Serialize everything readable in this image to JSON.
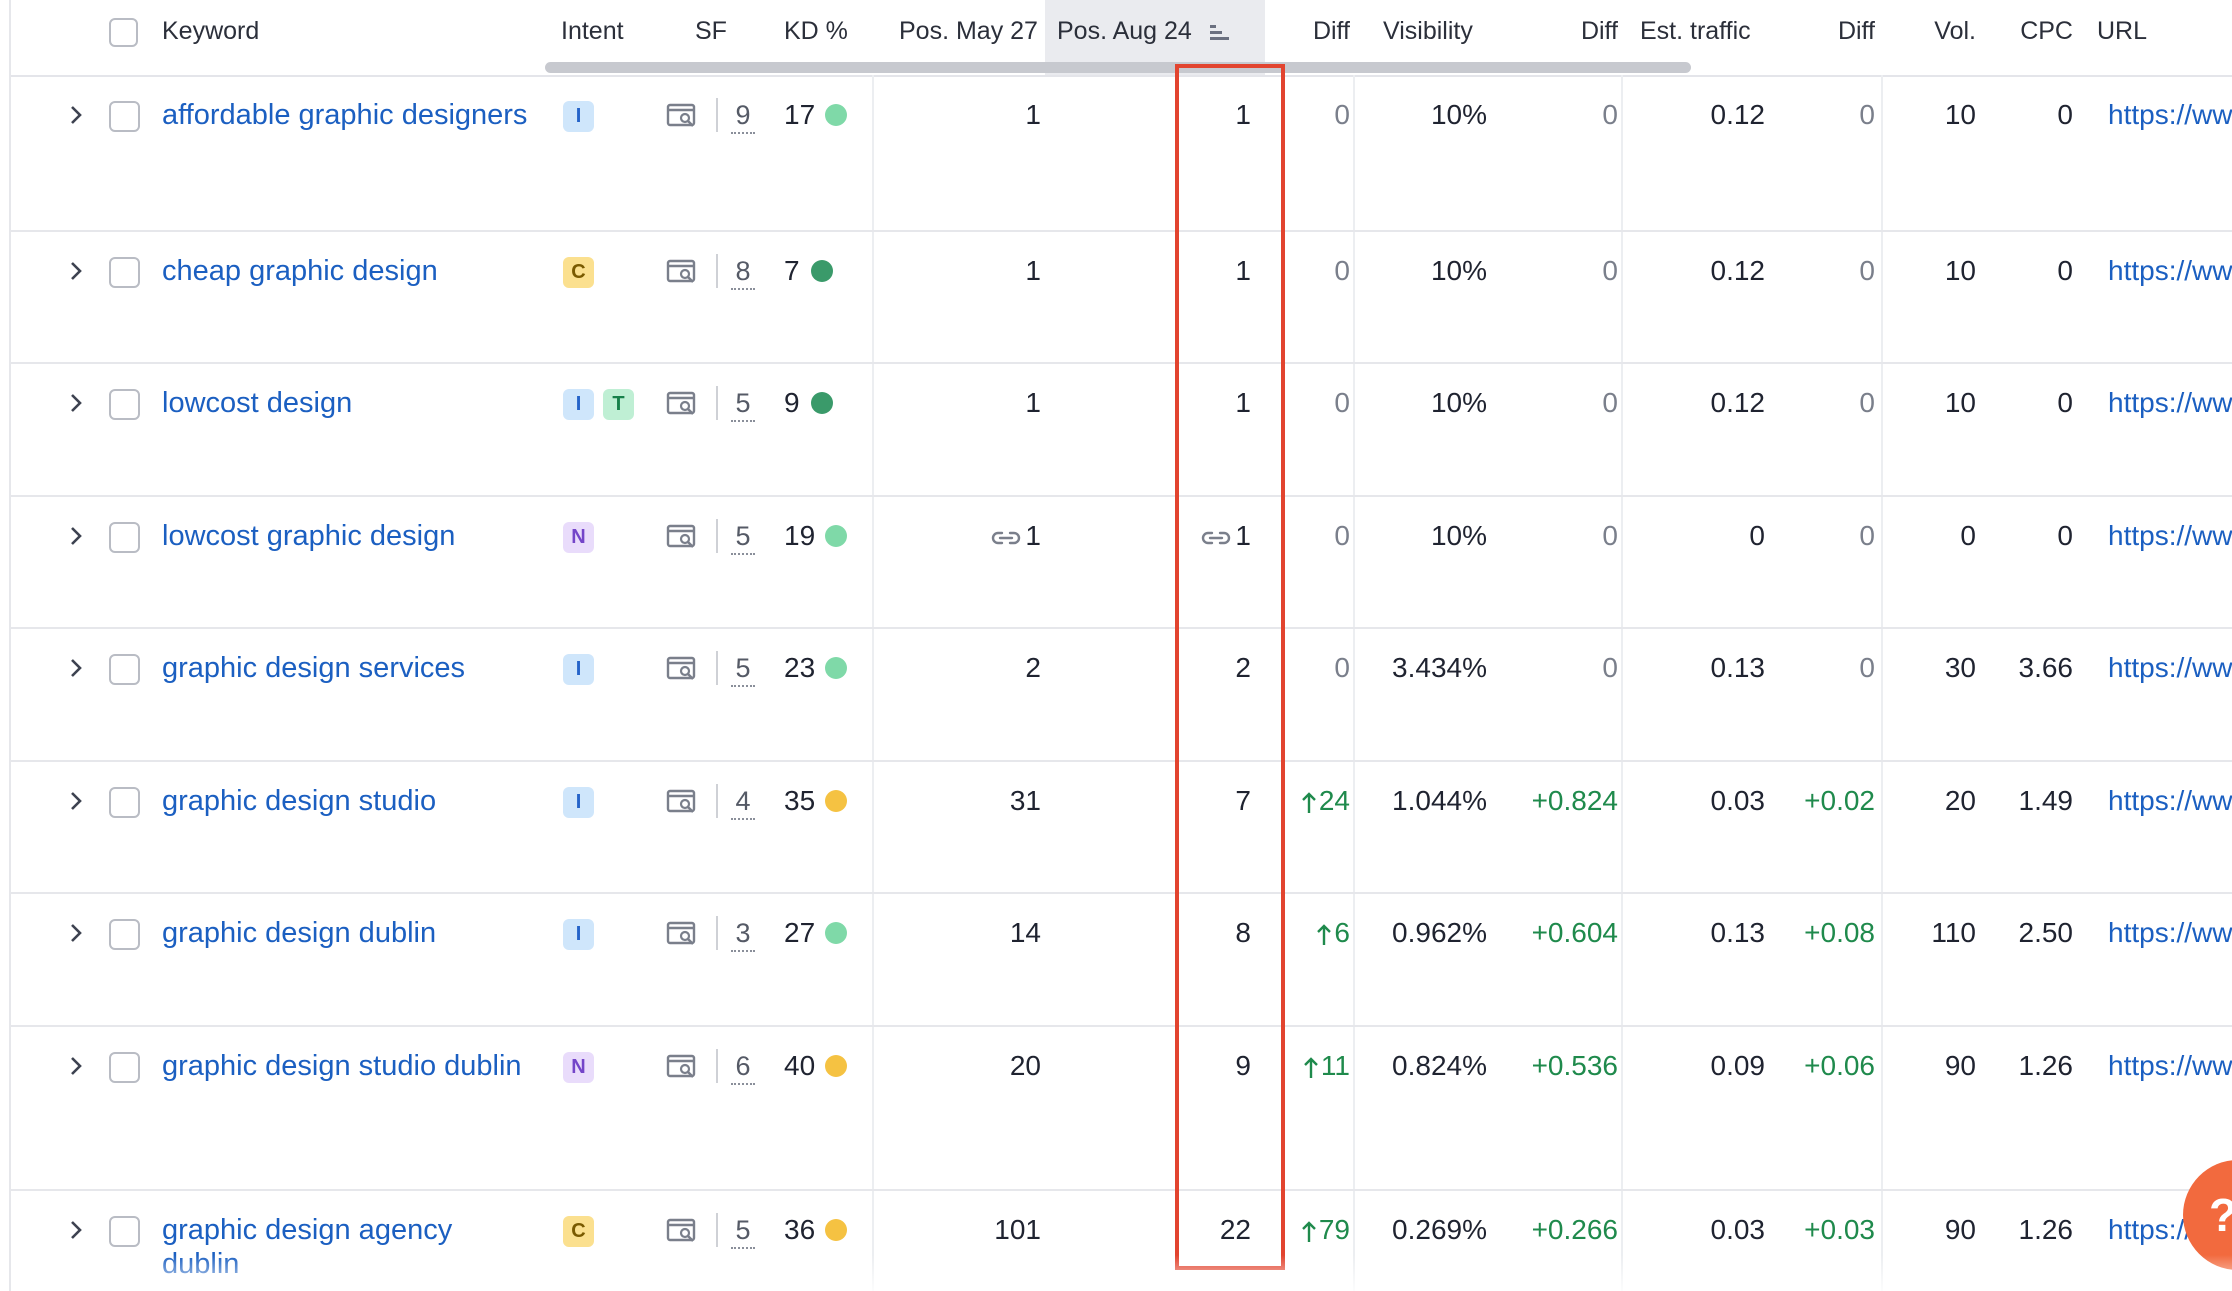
{
  "headers": {
    "keyword": "Keyword",
    "intent": "Intent",
    "sf": "SF",
    "kd": "KD %",
    "pos_may": "Pos. May 27",
    "pos_aug": "Pos. Aug 24",
    "diff_pos": "Diff",
    "visibility": "Visibility",
    "diff_vis": "Diff",
    "traffic": "Est. traffic",
    "diff_traffic": "Diff",
    "vol": "Vol.",
    "cpc": "CPC",
    "url": "URL"
  },
  "rows": [
    {
      "keyword": "affordable graphic designers",
      "intents": [
        "I"
      ],
      "sf": "9",
      "kd": "17",
      "kd_level": "light",
      "pos_may": "1",
      "pos_may_link": false,
      "pos_aug": "1",
      "pos_aug_link": false,
      "diff": "0",
      "diff_up": false,
      "visibility": "10%",
      "vis_diff": "0",
      "vis_diff_pos": false,
      "traffic": "0.12",
      "traffic_diff": "0",
      "traffic_diff_pos": false,
      "vol": "10",
      "cpc": "0",
      "url": "https://ww"
    },
    {
      "keyword": "cheap graphic design",
      "intents": [
        "C"
      ],
      "sf": "8",
      "kd": "7",
      "kd_level": "dark",
      "pos_may": "1",
      "pos_may_link": false,
      "pos_aug": "1",
      "pos_aug_link": false,
      "diff": "0",
      "diff_up": false,
      "visibility": "10%",
      "vis_diff": "0",
      "vis_diff_pos": false,
      "traffic": "0.12",
      "traffic_diff": "0",
      "traffic_diff_pos": false,
      "vol": "10",
      "cpc": "0",
      "url": "https://ww"
    },
    {
      "keyword": "lowcost design",
      "intents": [
        "I",
        "T"
      ],
      "sf": "5",
      "kd": "9",
      "kd_level": "dark",
      "pos_may": "1",
      "pos_may_link": false,
      "pos_aug": "1",
      "pos_aug_link": false,
      "diff": "0",
      "diff_up": false,
      "visibility": "10%",
      "vis_diff": "0",
      "vis_diff_pos": false,
      "traffic": "0.12",
      "traffic_diff": "0",
      "traffic_diff_pos": false,
      "vol": "10",
      "cpc": "0",
      "url": "https://ww"
    },
    {
      "keyword": "lowcost graphic design",
      "intents": [
        "N"
      ],
      "sf": "5",
      "kd": "19",
      "kd_level": "light",
      "pos_may": "1",
      "pos_may_link": true,
      "pos_aug": "1",
      "pos_aug_link": true,
      "diff": "0",
      "diff_up": false,
      "visibility": "10%",
      "vis_diff": "0",
      "vis_diff_pos": false,
      "traffic": "0",
      "traffic_diff": "0",
      "traffic_diff_pos": false,
      "vol": "0",
      "cpc": "0",
      "url": "https://ww"
    },
    {
      "keyword": "graphic design services",
      "intents": [
        "I"
      ],
      "sf": "5",
      "kd": "23",
      "kd_level": "light",
      "pos_may": "2",
      "pos_may_link": false,
      "pos_aug": "2",
      "pos_aug_link": false,
      "diff": "0",
      "diff_up": false,
      "visibility": "3.434%",
      "vis_diff": "0",
      "vis_diff_pos": false,
      "traffic": "0.13",
      "traffic_diff": "0",
      "traffic_diff_pos": false,
      "vol": "30",
      "cpc": "3.66",
      "url": "https://ww"
    },
    {
      "keyword": "graphic design studio",
      "intents": [
        "I"
      ],
      "sf": "4",
      "kd": "35",
      "kd_level": "yellow",
      "pos_may": "31",
      "pos_may_link": false,
      "pos_aug": "7",
      "pos_aug_link": false,
      "diff": "24",
      "diff_up": true,
      "visibility": "1.044%",
      "vis_diff": "+0.824",
      "vis_diff_pos": true,
      "traffic": "0.03",
      "traffic_diff": "+0.02",
      "traffic_diff_pos": true,
      "vol": "20",
      "cpc": "1.49",
      "url": "https://ww"
    },
    {
      "keyword": "graphic design dublin",
      "intents": [
        "I"
      ],
      "sf": "3",
      "kd": "27",
      "kd_level": "light",
      "pos_may": "14",
      "pos_may_link": false,
      "pos_aug": "8",
      "pos_aug_link": false,
      "diff": "6",
      "diff_up": true,
      "visibility": "0.962%",
      "vis_diff": "+0.604",
      "vis_diff_pos": true,
      "traffic": "0.13",
      "traffic_diff": "+0.08",
      "traffic_diff_pos": true,
      "vol": "110",
      "cpc": "2.50",
      "url": "https://ww"
    },
    {
      "keyword": "graphic design studio dublin",
      "intents": [
        "N"
      ],
      "sf": "6",
      "kd": "40",
      "kd_level": "yellow",
      "pos_may": "20",
      "pos_may_link": false,
      "pos_aug": "9",
      "pos_aug_link": false,
      "diff": "11",
      "diff_up": true,
      "visibility": "0.824%",
      "vis_diff": "+0.536",
      "vis_diff_pos": true,
      "traffic": "0.09",
      "traffic_diff": "+0.06",
      "traffic_diff_pos": true,
      "vol": "90",
      "cpc": "1.26",
      "url": "https://ww"
    },
    {
      "keyword": "graphic design agency dublin",
      "intents": [
        "C"
      ],
      "sf": "5",
      "kd": "36",
      "kd_level": "yellow",
      "pos_may": "101",
      "pos_may_link": false,
      "pos_aug": "22",
      "pos_aug_link": false,
      "diff": "79",
      "diff_up": true,
      "visibility": "0.269%",
      "vis_diff": "+0.266",
      "vis_diff_pos": true,
      "traffic": "0.03",
      "traffic_diff": "+0.03",
      "traffic_diff_pos": true,
      "vol": "90",
      "cpc": "1.26",
      "url": "https://"
    }
  ],
  "help_button": "?",
  "colors": {
    "link": "#1b5fc1",
    "positive": "#1f8a4c",
    "highlight": "#e2442f",
    "help": "#f26a3e"
  }
}
